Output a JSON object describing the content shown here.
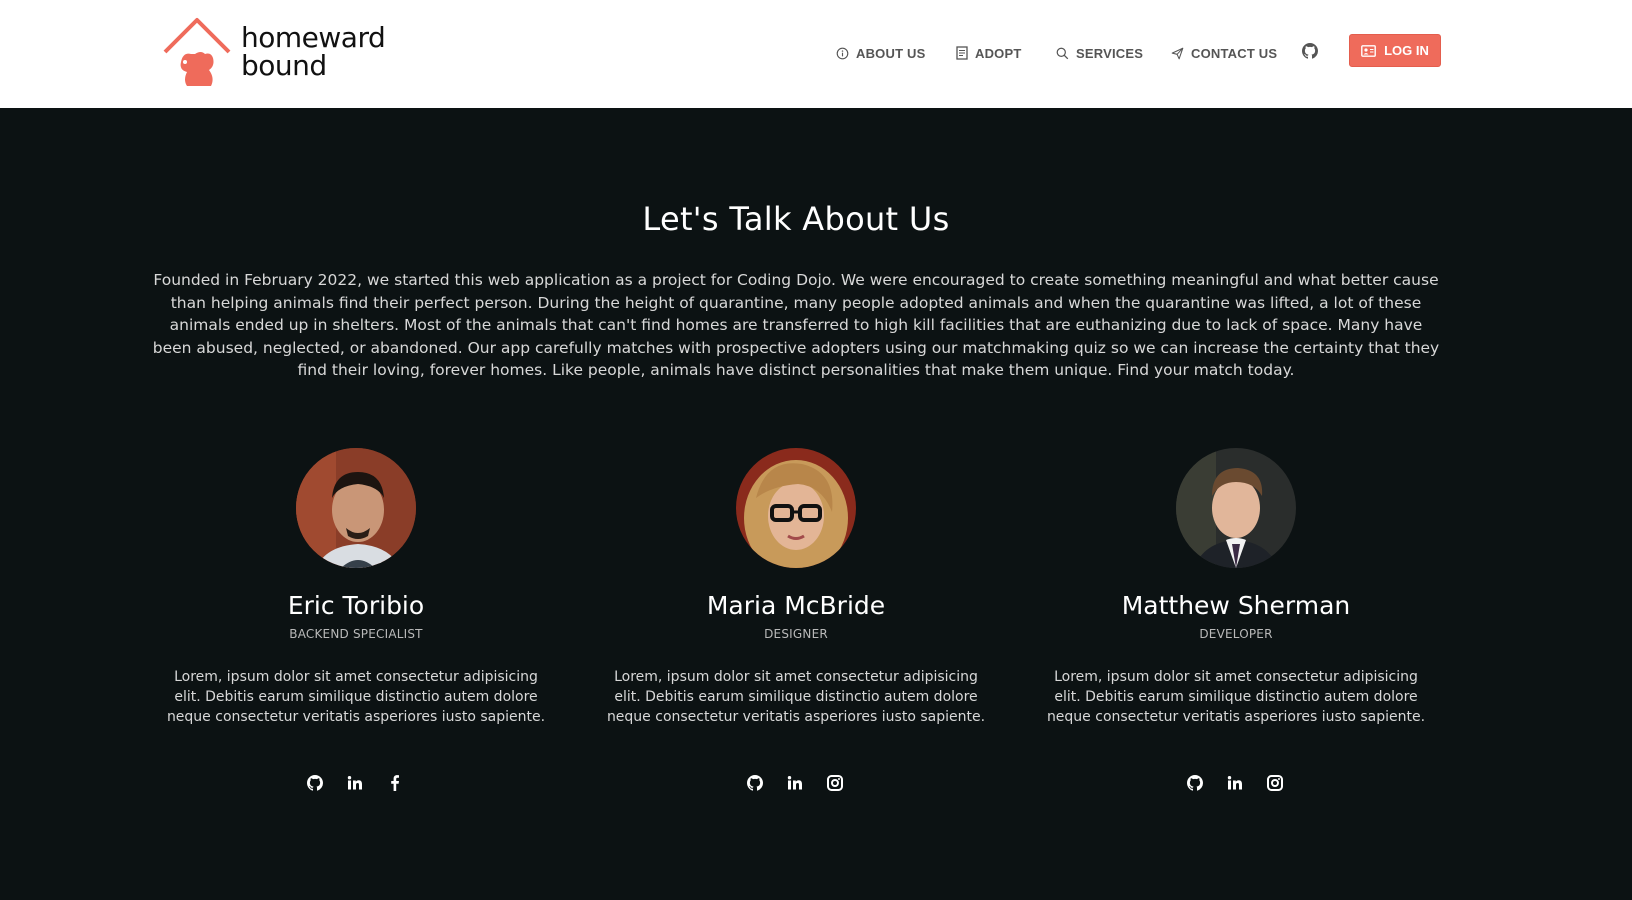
{
  "brand": {
    "line1": "homeward",
    "line2": "bound",
    "accent": "#ef6b5b"
  },
  "nav": {
    "items": [
      {
        "label": "ABOUT US",
        "icon": "info-icon"
      },
      {
        "label": "ADOPT",
        "icon": "document-icon"
      },
      {
        "label": "SERVICES",
        "icon": "search-icon"
      },
      {
        "label": "CONTACT US",
        "icon": "send-icon"
      }
    ],
    "github_icon": "github-icon",
    "login": {
      "label": "LOG IN",
      "icon": "id-card-icon"
    }
  },
  "about": {
    "title": "Let's Talk About Us",
    "body": "Founded in February 2022, we started this web application as a project for Coding Dojo. We were encouraged to create something meaningful and what better cause than helping animals find their perfect person. During the height of quarantine, many people adopted animals and when the quarantine was lifted, a lot of these animals ended up in shelters. Most of the animals that can't find homes are transferred to high kill facilities that are euthanizing due to lack of space. Many have been abused, neglected, or abandoned. Our app carefully matches with prospective adopters using our matchmaking quiz so we can increase the certainty that they find their loving, forever homes. Like people, animals have distinct personalities that make them unique. Find your match today."
  },
  "team": [
    {
      "name": "Eric Toribio",
      "role": "BACKEND SPECIALIST",
      "bio": "Lorem, ipsum dolor sit amet consectetur adipisicing elit. Debitis earum similique distinctio autem dolore neque consectetur veritatis asperiores iusto sapiente.",
      "socials": [
        "github-icon",
        "linkedin-icon",
        "facebook-icon"
      ]
    },
    {
      "name": "Maria McBride",
      "role": "DESIGNER",
      "bio": "Lorem, ipsum dolor sit amet consectetur adipisicing elit. Debitis earum similique distinctio autem dolore neque consectetur veritatis asperiores iusto sapiente.",
      "socials": [
        "github-icon",
        "linkedin-icon",
        "instagram-icon"
      ]
    },
    {
      "name": "Matthew Sherman",
      "role": "DEVELOPER",
      "bio": "Lorem, ipsum dolor sit amet consectetur adipisicing elit. Debitis earum similique distinctio autem dolore neque consectetur veritatis asperiores iusto sapiente.",
      "socials": [
        "github-icon",
        "linkedin-icon",
        "instagram-icon"
      ]
    }
  ]
}
